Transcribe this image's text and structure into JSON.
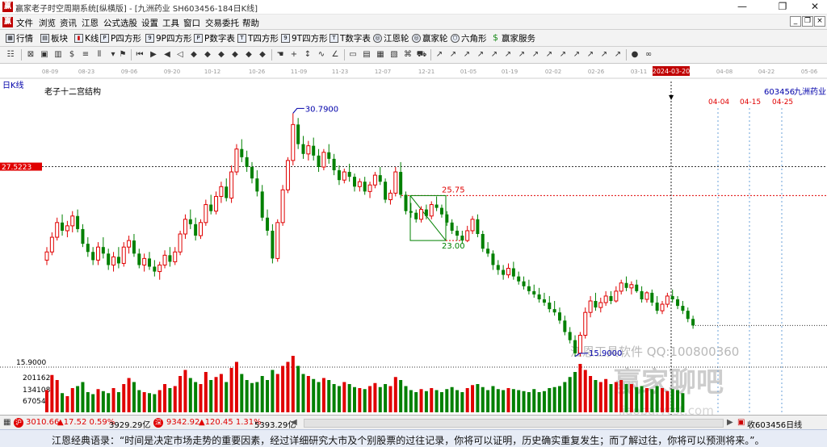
{
  "window": {
    "title": "赢家老子时空周期系统[纵横版] - [九洲药业  SH603456-184日K线]",
    "controls": [
      "—",
      "❐",
      "✕"
    ],
    "mdi_controls": [
      "_",
      "❐",
      "×"
    ]
  },
  "menu": [
    "文件",
    "浏览",
    "资讯",
    "江恩",
    "公式选股",
    "设置",
    "工具",
    "窗口",
    "交易委托",
    "帮助"
  ],
  "quickbar": [
    {
      "label": "行情",
      "icon": "grid-icon"
    },
    {
      "label": "板块",
      "icon": "blocks-icon"
    },
    {
      "label": "K线",
      "icon": "candle-icon"
    },
    {
      "label": "P四方形",
      "icon": "p-square-icon"
    },
    {
      "label": "9P四方形",
      "icon": "nine-p-icon"
    },
    {
      "label": "P数字表",
      "icon": "p-table-icon"
    },
    {
      "label": "T四方形",
      "icon": "t-square-icon"
    },
    {
      "label": "9T四方形",
      "icon": "nine-t-icon"
    },
    {
      "label": "T数字表",
      "icon": "t-table-icon"
    },
    {
      "label": "江恩轮",
      "icon": "wheel-icon"
    },
    {
      "label": "赢家轮",
      "icon": "winner-wheel-icon"
    },
    {
      "label": "六角形",
      "icon": "hexagon-icon"
    },
    {
      "label": "赢家服务",
      "icon": "dollar-icon"
    }
  ],
  "chart": {
    "period_label": "日K线",
    "indicator_label": "老子十二宫结构",
    "stock_code": "603456",
    "stock_name": "九洲药业",
    "current_date": "2024-03-20",
    "left_price_tag": "27.5223",
    "colors": {
      "up": "#e00000",
      "down": "#008000",
      "background": "#ffffff"
    },
    "date_axis": [
      "08-09",
      "08-23",
      "09-06",
      "09-20",
      "10-12",
      "10-26",
      "11-09",
      "11-23",
      "12-07",
      "12-21",
      "01-05",
      "01-19",
      "02-02",
      "02-26",
      "03-11",
      "2024-03-20",
      "04-08",
      "04-22",
      "05-06"
    ],
    "future_dates": [
      "04-04",
      "04-15",
      "04-25"
    ],
    "annotations": {
      "high": "30.7900",
      "low": "15.9000",
      "box_top": "25.75",
      "box_bottom": "23.00"
    },
    "volume_axis": [
      "201162",
      "134108",
      "67054"
    ],
    "price_axis_top": "15.9000",
    "watermark_main": "江恩工具软件  QQ:100800360",
    "watermark_brand": "赢家聊吧",
    "watermark_url": "jiaoba.ycst.com"
  },
  "chart_data": {
    "type": "candlestick",
    "ohlc": [
      [
        21.8,
        22.6,
        21.5,
        22.3
      ],
      [
        22.3,
        23.5,
        22.1,
        23.2
      ],
      [
        23.2,
        24.4,
        23.0,
        24.1
      ],
      [
        24.1,
        24.6,
        23.3,
        23.6
      ],
      [
        23.6,
        24.2,
        23.2,
        23.9
      ],
      [
        23.9,
        24.8,
        23.5,
        24.5
      ],
      [
        24.5,
        24.9,
        23.5,
        23.7
      ],
      [
        23.7,
        24.0,
        22.6,
        22.8
      ],
      [
        22.8,
        23.2,
        22.0,
        22.3
      ],
      [
        22.3,
        22.6,
        21.5,
        21.8
      ],
      [
        21.8,
        22.9,
        21.5,
        22.6
      ],
      [
        22.6,
        23.2,
        21.9,
        22.2
      ],
      [
        22.2,
        22.5,
        21.2,
        21.5
      ],
      [
        21.5,
        22.3,
        21.1,
        22.0
      ],
      [
        22.0,
        22.6,
        21.3,
        21.6
      ],
      [
        21.6,
        22.9,
        21.4,
        22.6
      ],
      [
        22.6,
        23.3,
        22.2,
        23.0
      ],
      [
        23.0,
        23.4,
        22.0,
        22.2
      ],
      [
        22.2,
        22.5,
        21.3,
        21.5
      ],
      [
        21.5,
        22.2,
        21.1,
        21.9
      ],
      [
        21.9,
        22.3,
        21.2,
        21.4
      ],
      [
        21.4,
        21.8,
        20.8,
        21.1
      ],
      [
        21.1,
        21.7,
        20.6,
        21.5
      ],
      [
        21.5,
        22.4,
        21.3,
        22.1
      ],
      [
        22.1,
        22.6,
        21.4,
        21.7
      ],
      [
        21.7,
        22.6,
        21.5,
        22.3
      ],
      [
        22.3,
        23.6,
        22.1,
        23.4
      ],
      [
        23.4,
        24.6,
        23.1,
        24.3
      ],
      [
        24.3,
        24.9,
        23.7,
        24.0
      ],
      [
        24.0,
        24.4,
        23.0,
        23.3
      ],
      [
        23.3,
        24.3,
        23.1,
        24.1
      ],
      [
        24.1,
        25.5,
        23.9,
        25.2
      ],
      [
        25.2,
        25.8,
        24.6,
        24.8
      ],
      [
        24.8,
        26.0,
        24.6,
        25.7
      ],
      [
        25.7,
        26.6,
        25.3,
        26.3
      ],
      [
        26.3,
        26.8,
        25.4,
        25.6
      ],
      [
        25.6,
        27.6,
        25.3,
        27.2
      ],
      [
        27.2,
        28.9,
        27.0,
        28.6
      ],
      [
        28.6,
        29.2,
        27.8,
        28.1
      ],
      [
        28.1,
        28.5,
        27.2,
        27.5
      ],
      [
        27.5,
        27.8,
        26.5,
        26.8
      ],
      [
        26.8,
        27.3,
        25.7,
        26.0
      ],
      [
        26.0,
        26.4,
        24.2,
        24.4
      ],
      [
        24.4,
        24.9,
        23.3,
        23.6
      ],
      [
        23.6,
        24.0,
        21.6,
        21.9
      ],
      [
        21.9,
        24.3,
        21.7,
        24.1
      ],
      [
        24.1,
        26.4,
        23.9,
        26.1
      ],
      [
        26.1,
        28.1,
        25.9,
        27.9
      ],
      [
        27.9,
        30.79,
        27.6,
        30.1
      ],
      [
        30.1,
        30.5,
        28.6,
        28.9
      ],
      [
        28.9,
        29.4,
        28.0,
        28.3
      ],
      [
        28.3,
        29.1,
        27.9,
        28.8
      ],
      [
        28.8,
        29.3,
        27.9,
        28.2
      ],
      [
        28.2,
        28.6,
        27.2,
        27.5
      ],
      [
        27.5,
        28.6,
        27.3,
        28.4
      ],
      [
        28.4,
        28.9,
        27.7,
        28.0
      ],
      [
        28.0,
        28.3,
        27.0,
        27.3
      ],
      [
        27.3,
        27.6,
        26.4,
        26.7
      ],
      [
        26.7,
        27.4,
        26.5,
        27.2
      ],
      [
        27.2,
        27.7,
        26.6,
        26.9
      ],
      [
        26.9,
        27.1,
        26.0,
        26.3
      ],
      [
        26.3,
        26.8,
        26.0,
        26.6
      ],
      [
        26.6,
        26.9,
        25.8,
        26.0
      ],
      [
        26.0,
        26.6,
        25.6,
        26.4
      ],
      [
        26.4,
        27.2,
        26.2,
        27.0
      ],
      [
        27.0,
        27.5,
        26.4,
        26.6
      ],
      [
        26.6,
        26.8,
        25.3,
        25.5
      ],
      [
        25.5,
        26.1,
        25.2,
        25.9
      ],
      [
        25.9,
        27.5,
        25.7,
        27.2
      ],
      [
        27.2,
        27.8,
        25.6,
        25.8
      ],
      [
        25.8,
        26.0,
        24.6,
        24.8
      ],
      [
        24.8,
        25.3,
        24.4,
        24.7
      ],
      [
        24.7,
        24.9,
        24.1,
        24.3
      ],
      [
        24.3,
        25.1,
        24.1,
        24.9
      ],
      [
        24.9,
        25.2,
        24.3,
        24.5
      ],
      [
        24.5,
        25.4,
        24.3,
        25.2
      ],
      [
        25.2,
        25.7,
        24.8,
        25.0
      ],
      [
        25.0,
        25.2,
        24.4,
        24.6
      ],
      [
        24.6,
        24.8,
        23.9,
        24.1
      ],
      [
        24.1,
        24.3,
        23.4,
        23.6
      ],
      [
        23.6,
        23.9,
        23.0,
        23.3
      ],
      [
        23.3,
        23.6,
        22.8,
        23.0
      ],
      [
        23.0,
        23.9,
        22.9,
        23.6
      ],
      [
        23.6,
        24.5,
        23.4,
        24.3
      ],
      [
        24.3,
        24.6,
        23.2,
        23.4
      ],
      [
        23.4,
        23.6,
        22.3,
        22.5
      ],
      [
        22.5,
        22.9,
        22.0,
        22.2
      ],
      [
        22.2,
        22.4,
        21.2,
        21.5
      ],
      [
        21.5,
        21.8,
        20.9,
        21.2
      ],
      [
        21.2,
        21.5,
        20.6,
        20.9
      ],
      [
        20.9,
        21.6,
        20.7,
        21.3
      ],
      [
        21.3,
        21.7,
        20.6,
        20.8
      ],
      [
        20.8,
        21.1,
        20.3,
        20.5
      ],
      [
        20.5,
        20.8,
        20.0,
        20.2
      ],
      [
        20.2,
        20.6,
        19.7,
        19.9
      ],
      [
        19.9,
        20.3,
        19.5,
        19.7
      ],
      [
        19.7,
        20.1,
        19.2,
        19.4
      ],
      [
        19.4,
        19.8,
        19.0,
        19.2
      ],
      [
        19.2,
        19.6,
        18.6,
        18.8
      ],
      [
        18.8,
        19.3,
        18.4,
        18.6
      ],
      [
        18.6,
        18.9,
        17.9,
        18.1
      ],
      [
        18.1,
        18.4,
        17.2,
        17.4
      ],
      [
        17.4,
        17.7,
        16.7,
        16.9
      ],
      [
        16.9,
        17.2,
        15.9,
        16.1
      ],
      [
        16.1,
        17.4,
        15.9,
        17.2
      ],
      [
        17.2,
        18.9,
        17.0,
        18.6
      ],
      [
        18.6,
        19.6,
        18.3,
        19.3
      ],
      [
        19.3,
        19.8,
        18.7,
        18.9
      ],
      [
        18.9,
        19.5,
        18.6,
        19.2
      ],
      [
        19.2,
        19.9,
        19.0,
        19.6
      ],
      [
        19.6,
        19.9,
        19.1,
        19.3
      ],
      [
        19.3,
        20.2,
        19.2,
        19.9
      ],
      [
        19.9,
        20.6,
        19.7,
        20.4
      ],
      [
        20.4,
        20.8,
        19.9,
        20.1
      ],
      [
        20.1,
        20.5,
        19.7,
        20.3
      ],
      [
        20.3,
        20.6,
        19.8,
        19.9
      ],
      [
        19.9,
        20.2,
        19.2,
        19.4
      ],
      [
        19.4,
        19.9,
        19.2,
        19.8
      ],
      [
        19.8,
        20.0,
        19.0,
        19.2
      ],
      [
        19.2,
        19.6,
        18.5,
        18.7
      ],
      [
        18.7,
        19.3,
        18.5,
        19.1
      ],
      [
        19.1,
        19.8,
        18.9,
        19.6
      ],
      [
        19.6,
        20.0,
        19.2,
        19.4
      ],
      [
        19.4,
        19.6,
        18.8,
        19.0
      ],
      [
        19.0,
        19.3,
        18.5,
        18.7
      ],
      [
        18.7,
        18.9,
        18.0,
        18.2
      ],
      [
        18.2,
        18.4,
        17.6,
        17.8
      ]
    ],
    "volume": [
      110,
      185,
      160,
      95,
      80,
      120,
      130,
      150,
      100,
      90,
      115,
      105,
      95,
      120,
      100,
      140,
      170,
      150,
      110,
      100,
      95,
      90,
      110,
      140,
      120,
      130,
      180,
      210,
      170,
      150,
      140,
      200,
      160,
      175,
      190,
      150,
      220,
      250,
      190,
      160,
      145,
      150,
      180,
      160,
      210,
      190,
      230,
      250,
      280,
      230,
      190,
      180,
      165,
      150,
      170,
      160,
      140,
      130,
      150,
      140,
      125,
      120,
      115,
      130,
      145,
      125,
      140,
      130,
      175,
      160,
      130,
      110,
      100,
      115,
      105,
      120,
      110,
      100,
      115,
      125,
      110,
      100,
      120,
      135,
      140,
      125,
      110,
      130,
      115,
      110,
      120,
      115,
      110,
      105,
      100,
      115,
      100,
      105,
      120,
      125,
      130,
      150,
      175,
      200,
      240,
      210,
      180,
      160,
      150,
      165,
      140,
      150,
      160,
      140,
      140,
      125,
      130,
      120,
      115,
      130,
      120,
      105,
      115,
      110,
      95
    ],
    "high": 30.79,
    "low": 15.9,
    "box": [
      23.0,
      25.75
    ],
    "ref_line": 27.5223,
    "last_close_line": 17.8
  },
  "statusbar": {
    "index1": "3010.66",
    "index1_change": "▲17.52 0.59%",
    "index1_amount": "3929.29亿",
    "index2": "9342.92",
    "index2_change": "▲120.45 1.31%",
    "index2_amount": "5393.29亿",
    "right": "收603456日线"
  },
  "quote": "江恩经典语录：“时间是决定市场走势的重要因素，经过详细研究大市及个别股票的过往记录，你将可以证明，历史确实重复发生；而了解过往，你将可以预测将来。”。"
}
